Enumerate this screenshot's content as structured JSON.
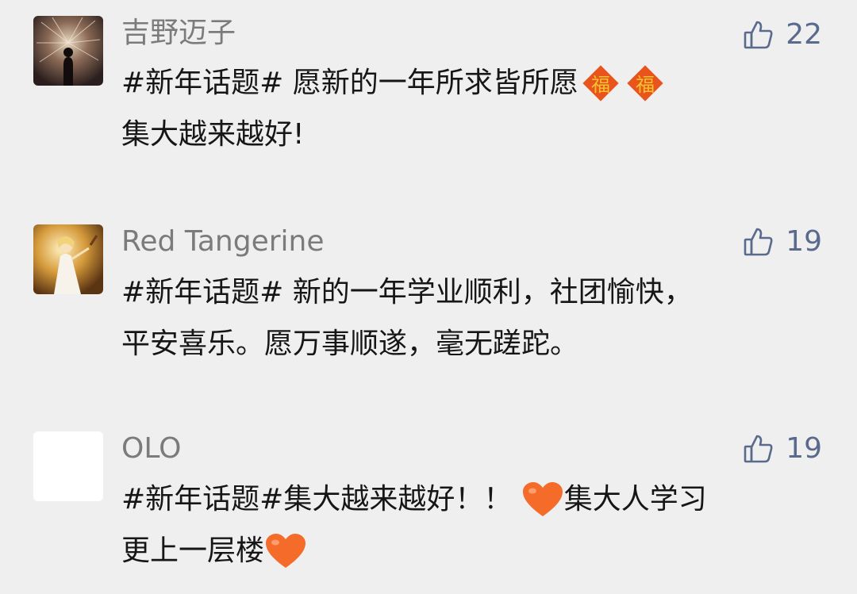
{
  "comments": [
    {
      "username": "吉野迈子",
      "likes": "22",
      "text_parts": [
        "#新年话题#  愿新的一年所求皆所愿",
        "集大越来越好!"
      ],
      "emoji": [
        "fu-charm-icon",
        "fu-charm-icon"
      ]
    },
    {
      "username": "Red Tangerine",
      "likes": "19",
      "text_parts": [
        "#新年话题# 新的一年学业顺利，社团愉快，",
        "平安喜乐。愿万事顺遂，毫无蹉跎。"
      ]
    },
    {
      "username": "OLO",
      "likes": "19",
      "text_parts": [
        "#新年话题#集大越来越好！！",
        "集大人学习",
        "更上一层楼"
      ],
      "emoji": [
        "heart-icon",
        "heart-icon"
      ]
    }
  ],
  "colors": {
    "background": "#efefef",
    "username": "#7b7b7b",
    "like_count": "#5a6a8c",
    "text": "#161616",
    "heart": "#f46b2a",
    "fu_charm": "#e8541c"
  }
}
